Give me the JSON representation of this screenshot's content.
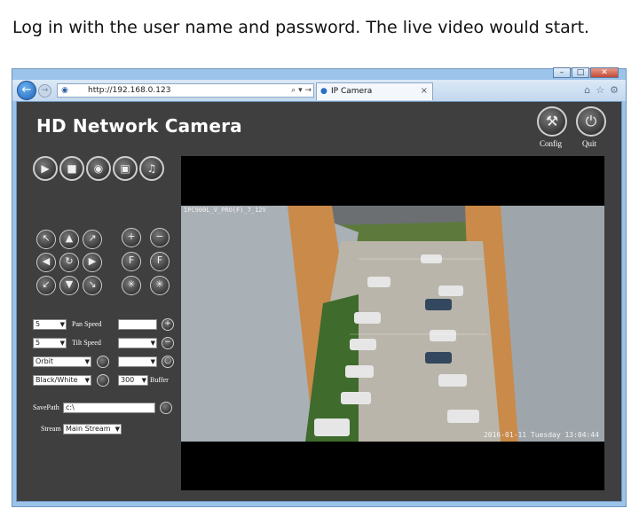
{
  "caption": "Log in with the user name and password. The live video would start.",
  "browser": {
    "url": "http://192.168.0.123",
    "tab_title": "IP Camera",
    "address_controls": "⌕ ▾ →",
    "window_buttons": [
      "–",
      "□",
      "✕"
    ]
  },
  "app": {
    "title": "HD Network Camera",
    "config_label": "Config",
    "quit_label": "Quit"
  },
  "controls": {
    "pan_speed_value": "5",
    "pan_speed_label": "Pan Speed",
    "tilt_speed_value": "5",
    "tilt_speed_label": "Tilt Speed",
    "orbit_value": "Orbit",
    "color_mode_value": "Black/White",
    "buffer_value": "300",
    "buffer_label": "Buffer",
    "savepath_label": "SavePath",
    "savepath_value": "c:\\",
    "stream_label": "Stream",
    "stream_value": "Main Stream"
  },
  "video": {
    "osd_top": "IPC900L_V_PRO(F)_7_12V",
    "osd_bottom": "2016-01-11 Tuesday 13:04:44"
  },
  "icons": {
    "back": "back-arrow-icon",
    "forward": "forward-arrow-icon",
    "play": "play-icon",
    "stop": "stop-icon",
    "snapshot": "camera-icon",
    "record": "record-icon",
    "audio": "microphone-icon",
    "config": "wrench-icon",
    "quit": "power-icon"
  },
  "colors": {
    "app_background": "#3f3f3f",
    "browser_chrome": "#9cc4ea",
    "video_background": "#000000"
  }
}
